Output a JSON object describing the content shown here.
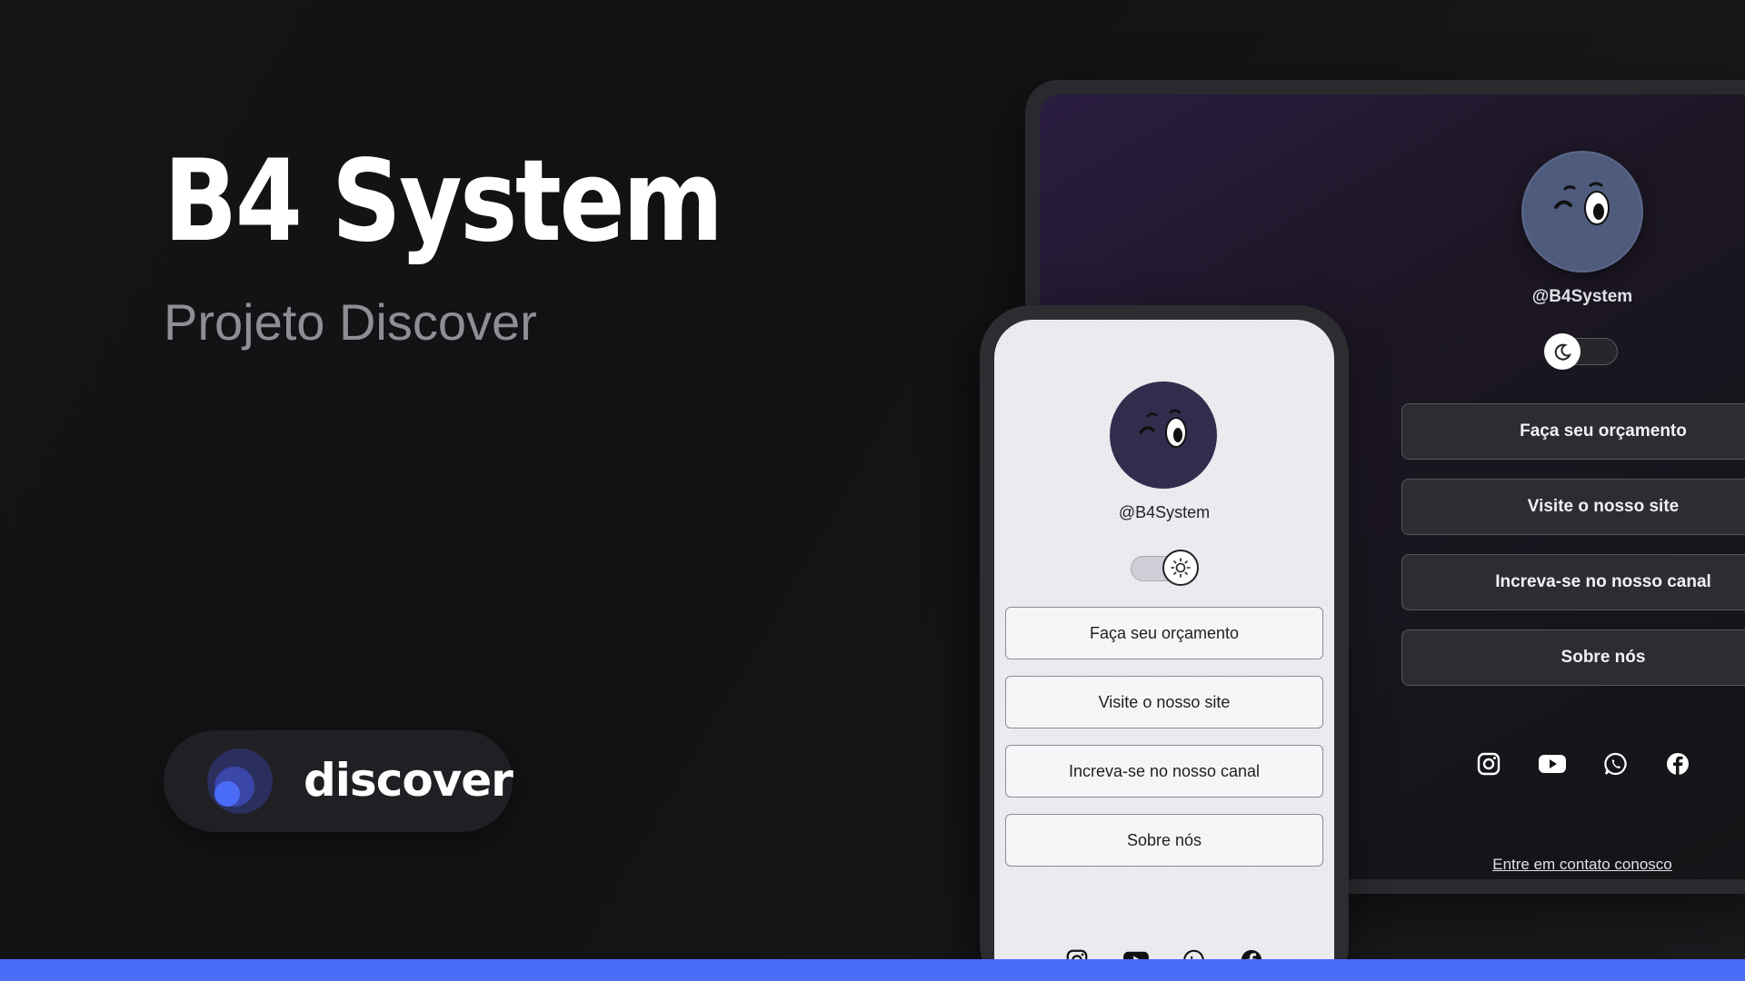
{
  "hero": {
    "title": "B4 System",
    "subtitle": "Projeto Discover"
  },
  "badge": {
    "label": "discover",
    "logo_icon": "discover-logo-icon"
  },
  "colors": {
    "accent": "#4a6cf7",
    "background": "#121214",
    "pill_background": "#202024",
    "phone_screen": "#ecebf0",
    "desktop_screen_top": "#2a1d40",
    "avatar_desktop": "#4e5b7d",
    "avatar_phone": "#312d4d"
  },
  "desktop": {
    "handle": "@B4System",
    "theme_toggle_icon": "moon-icon",
    "links": [
      {
        "label": "Faça seu orçamento"
      },
      {
        "label": "Visite o nosso site"
      },
      {
        "label": "Increva-se no nosso canal"
      },
      {
        "label": "Sobre nós"
      }
    ],
    "social_icons": [
      "instagram-icon",
      "youtube-icon",
      "whatsapp-icon",
      "facebook-icon"
    ],
    "contact_link": "Entre em contato conosco"
  },
  "phone": {
    "handle": "@B4System",
    "theme_toggle_icon": "sun-icon",
    "links": [
      {
        "label": "Faça seu orçamento"
      },
      {
        "label": "Visite o nosso site"
      },
      {
        "label": "Increva-se no nosso canal"
      },
      {
        "label": "Sobre nós"
      }
    ],
    "social_icons": [
      "instagram-icon",
      "youtube-icon",
      "whatsapp-icon",
      "facebook-icon"
    ]
  }
}
